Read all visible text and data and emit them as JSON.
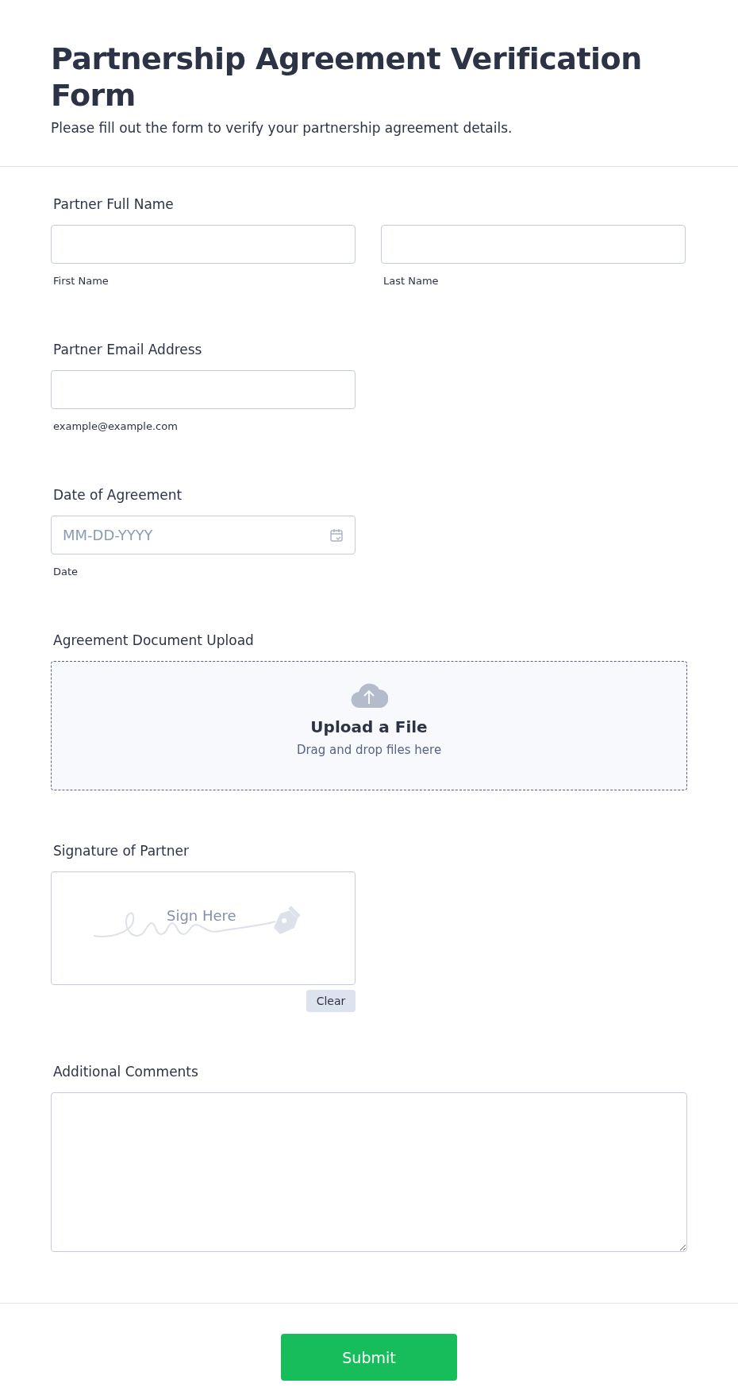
{
  "header": {
    "title": "Partnership Agreement Verification Form",
    "subtitle": "Please fill out the form to verify your partnership agreement details."
  },
  "fields": [
    {
      "kind": "name",
      "label": "Partner Full Name",
      "sublabels": [
        "First Name",
        "Last Name"
      ]
    },
    {
      "kind": "email",
      "label": "Partner Email Address",
      "sublabel": "example@example.com"
    },
    {
      "kind": "date",
      "label": "Date of Agreement",
      "placeholder": "MM-DD-YYYY",
      "sublabel": "Date"
    },
    {
      "kind": "upload",
      "label": "Agreement Document Upload",
      "title": "Upload a File",
      "hint": "Drag and drop files here"
    },
    {
      "kind": "signature",
      "label": "Signature of Partner",
      "hint": "Sign Here",
      "button": "Clear"
    },
    {
      "kind": "textarea",
      "label": "Additional Comments"
    }
  ],
  "submit": "Submit"
}
